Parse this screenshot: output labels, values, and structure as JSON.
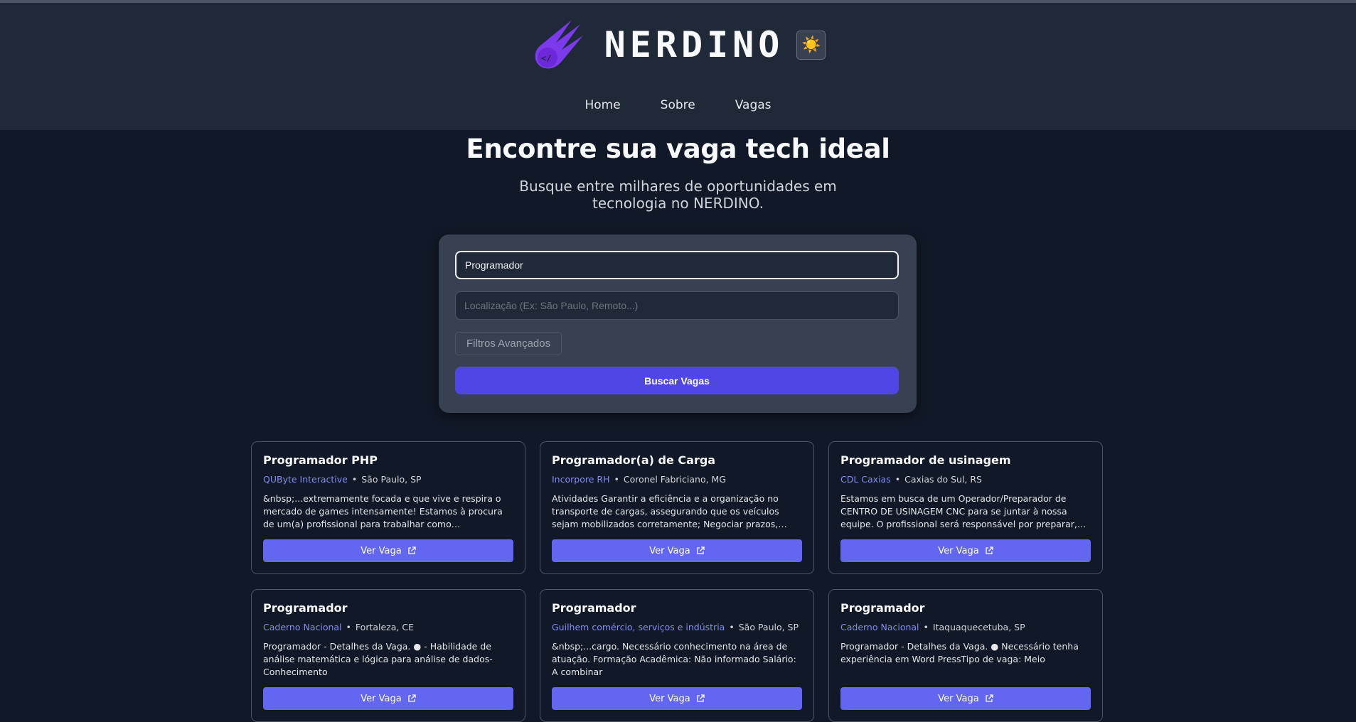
{
  "header": {
    "brand": "NERDINO",
    "logo_icon": "comet-code-logo",
    "theme_toggle_icon": "☀️",
    "nav": [
      "Home",
      "Sobre",
      "Vagas"
    ]
  },
  "hero": {
    "title": "Encontre sua vaga tech ideal",
    "subtitle": "Busque entre milhares de oportunidades em tecnologia no NERDINO."
  },
  "search": {
    "query_value": "Programador",
    "location_value": "",
    "location_placeholder": "Localização (Ex: São Paulo, Remoto...)",
    "filters_label": "Filtros Avançados",
    "submit_label": "Buscar Vagas"
  },
  "jobs": [
    {
      "title": "Programador PHP",
      "company": "QUByte Interactive",
      "location": "São Paulo, SP",
      "description": "&nbsp;...extremamente focada e que vive e respira o mercado de games intensamente! Estamos à procura de um(a) profissional para trabalhar como Programador(a) PHP...",
      "button": "Ver Vaga"
    },
    {
      "title": "Programador(a) de Carga",
      "company": "Incorpore RH",
      "location": "Coronel Fabriciano, MG",
      "description": "Atividades Garantir a eficiência e a organização no transporte de cargas, assegurando que os veículos sejam mobilizados corretamente; Negociar prazos, condições e alinhar...",
      "button": "Ver Vaga"
    },
    {
      "title": "Programador de usinagem",
      "company": "CDL Caxias",
      "location": "Caxias do Sul, RS",
      "description": "Estamos em busca de um Operador/Preparador de CENTRO DE USINAGEM CNC para se juntar à nossa equipe. O profissional será responsável por preparar, regular e operar...",
      "button": "Ver Vaga"
    },
    {
      "title": "Programador",
      "company": "Caderno Nacional",
      "location": "Fortaleza, CE",
      "description": "Programador - Detalhes da Vaga. ● - Habilidade de análise matemática e lógica para análise de dados- Conhecimento",
      "button": "Ver Vaga"
    },
    {
      "title": "Programador",
      "company": "Guilhem comércio, serviços e indústria",
      "location": "São Paulo, SP",
      "description": "&nbsp;...cargo. Necessário conhecimento na área de atuação. Formação Acadêmica: Não informado Salário: A combinar",
      "button": "Ver Vaga"
    },
    {
      "title": "Programador",
      "company": "Caderno Nacional",
      "location": "Itaquaquecetuba, SP",
      "description": "Programador - Detalhes da Vaga. ● Necessário tenha experiência em Word PressTipo de vaga: Meio",
      "button": "Ver Vaga"
    }
  ],
  "colors": {
    "page_bg": "#111827",
    "header_bg": "#1f2937",
    "card_bg": "#374151",
    "primary": "#4f46e5",
    "button": "#6366f1",
    "company_link": "#818cf8",
    "logo": "#7c3aed"
  }
}
